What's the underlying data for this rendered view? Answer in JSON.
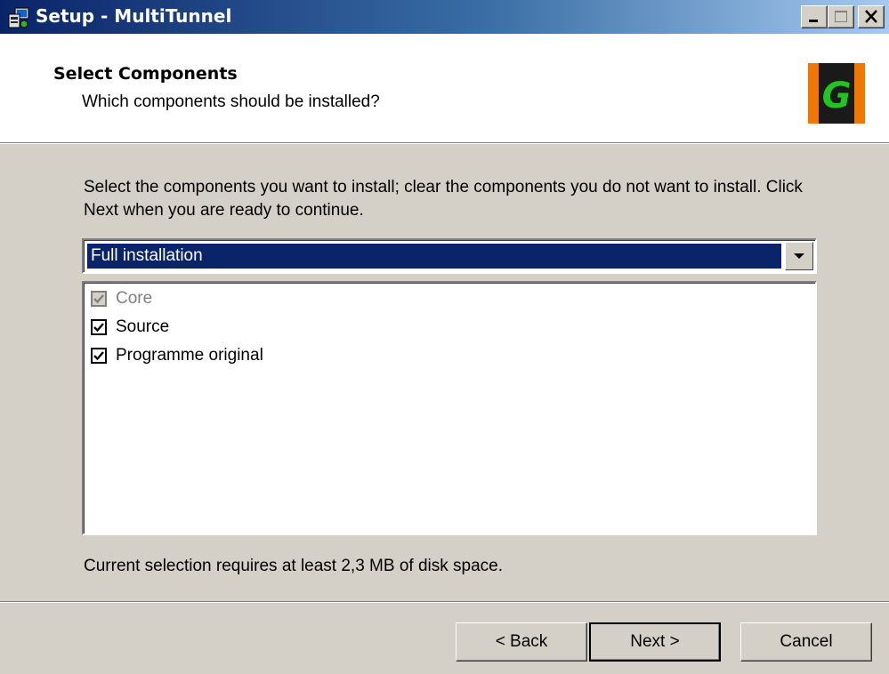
{
  "window": {
    "title": "Setup - MultiTunnel",
    "icon": "setup-computer-icon",
    "controls": [
      "minimize-icon",
      "maximize-icon",
      "close-icon"
    ]
  },
  "header": {
    "title": "Select Components",
    "subtitle": "Which components should be installed?",
    "logo_letter": "G",
    "logo_colors": {
      "outer": "#f07800",
      "inner": "#1a1a1a",
      "letter": "#21c421"
    }
  },
  "description": "Select the components you want to install; clear the components you do not want to install. Click Next when you are ready to continue.",
  "install_type": {
    "selected": "Full installation"
  },
  "components": [
    {
      "label": "Core",
      "checked": true,
      "enabled": false
    },
    {
      "label": "Source",
      "checked": true,
      "enabled": true
    },
    {
      "label": "Programme original",
      "checked": true,
      "enabled": true
    }
  ],
  "disk_requirement": "Current selection requires at least 2,3 MB of disk space.",
  "buttons": {
    "back": "< Back",
    "next": "Next >",
    "cancel": "Cancel"
  },
  "colors": {
    "titlebar_start": "#0a246a",
    "titlebar_end": "#a6caf0",
    "selection": "#0a246a",
    "face": "#d4d0c8"
  }
}
